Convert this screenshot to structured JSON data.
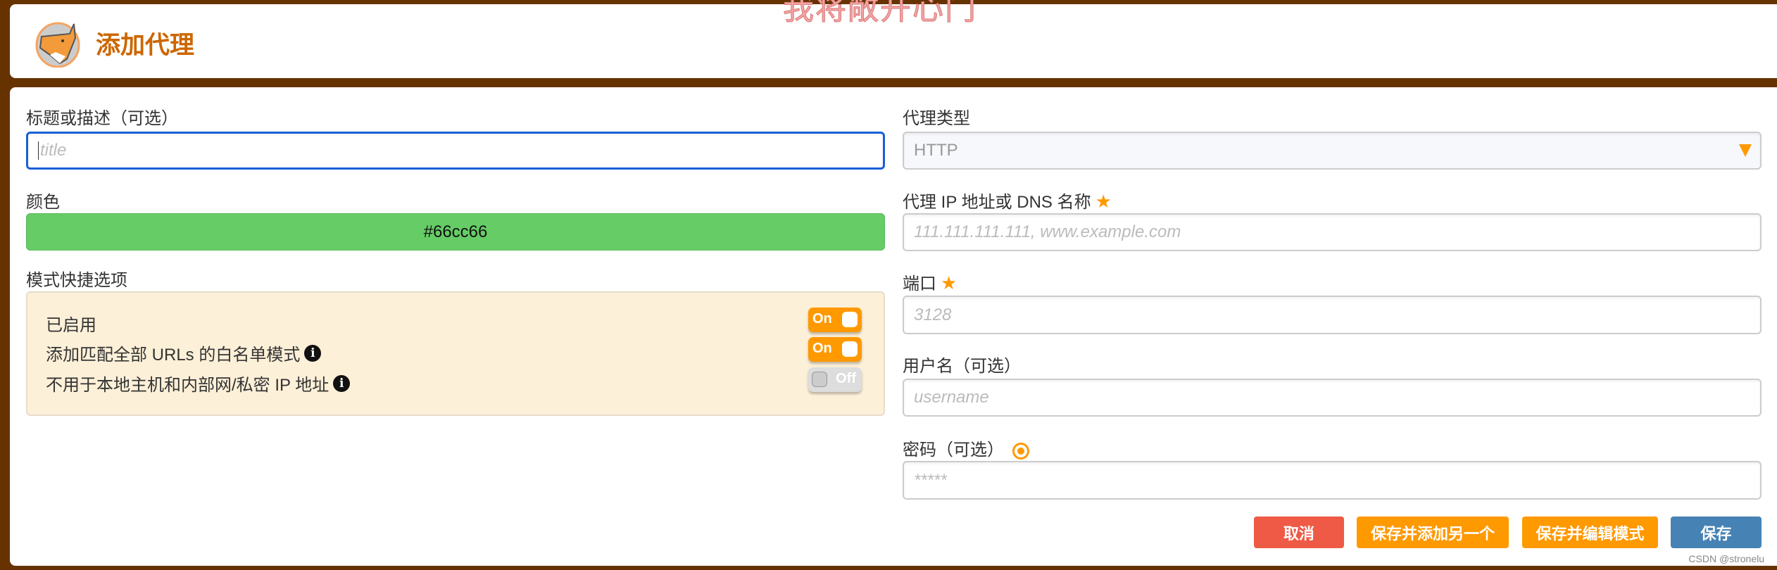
{
  "watermark": "我将敞开心门",
  "header": {
    "title": "添加代理",
    "logo": "foxyproxy-fox-logo"
  },
  "left": {
    "title_label": "标题或描述（可选）",
    "title_placeholder": "title",
    "color_label": "颜色",
    "color_value": "#66cc66",
    "pattern_label": "模式快捷选项",
    "patterns": [
      {
        "label": "已启用",
        "toggle": "On",
        "state": true,
        "info": false
      },
      {
        "label": "添加匹配全部 URLs 的白名单模式",
        "toggle": "On",
        "state": true,
        "info": true
      },
      {
        "label": "不用于本地主机和内部网/私密 IP 地址",
        "toggle": "Off",
        "state": false,
        "info": true
      }
    ]
  },
  "right": {
    "type_label": "代理类型",
    "type_value": "HTTP",
    "host_label": "代理 IP 地址或 DNS 名称",
    "host_placeholder": "111.111.111.111, www.example.com",
    "port_label": "端口",
    "port_placeholder": "3128",
    "user_label": "用户名（可选）",
    "user_placeholder": "username",
    "pass_label": "密码（可选）",
    "pass_placeholder": "*****"
  },
  "buttons": {
    "cancel": "取消",
    "save_add": "保存并添加另一个",
    "save_edit": "保存并编辑模式",
    "save": "保存"
  },
  "colors": {
    "background": "#663300",
    "accent": "#ff9900",
    "title": "#cc6600",
    "cancel": "#ee5a45",
    "save": "#4682b4"
  },
  "credit": "CSDN @stronelu"
}
